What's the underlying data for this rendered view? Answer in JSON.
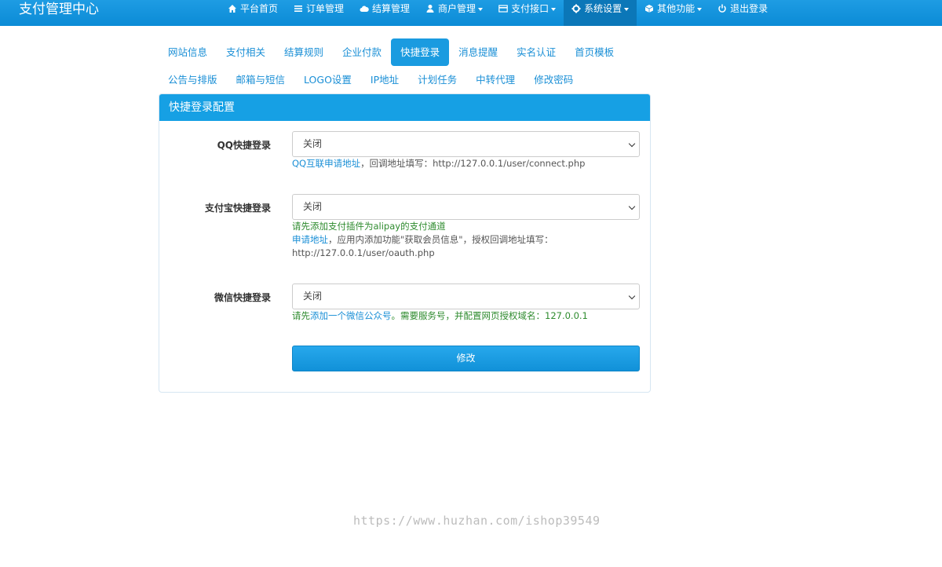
{
  "brand": "支付管理中心",
  "nav": [
    {
      "label": "平台首页",
      "icon": "home-icon"
    },
    {
      "label": "订单管理",
      "icon": "list-icon"
    },
    {
      "label": "结算管理",
      "icon": "cloud-icon"
    },
    {
      "label": "商户管理",
      "icon": "user-icon",
      "dropdown": true
    },
    {
      "label": "支付接口",
      "icon": "card-icon",
      "dropdown": true
    },
    {
      "label": "系统设置",
      "icon": "gear-icon",
      "dropdown": true,
      "active": true
    },
    {
      "label": "其他功能",
      "icon": "cube-icon",
      "dropdown": true
    },
    {
      "label": "退出登录",
      "icon": "power-icon"
    }
  ],
  "tabs": {
    "row1": [
      "网站信息",
      "支付相关",
      "结算规则",
      "企业付款",
      "快捷登录",
      "消息提醒",
      "实名认证",
      "首页模板"
    ],
    "row2": [
      "公告与排版",
      "邮箱与短信",
      "LOGO设置",
      "IP地址",
      "计划任务",
      "中转代理",
      "修改密码"
    ],
    "active": "快捷登录"
  },
  "panel": {
    "title": "快捷登录配置",
    "qq": {
      "label": "QQ快捷登录",
      "value": "关闭",
      "help_link": "QQ互联申请地址",
      "help_text": "，回调地址填写：http://127.0.0.1/user/connect.php"
    },
    "alipay": {
      "label": "支付宝快捷登录",
      "value": "关闭",
      "help_notice": "请先添加支付插件为alipay的支付通道",
      "help_link": "申请地址",
      "help_text": "，应用内添加功能\"获取会员信息\"，授权回调地址填写：",
      "help_url": "http://127.0.0.1/user/oauth.php"
    },
    "wechat": {
      "label": "微信快捷登录",
      "value": "关闭",
      "help_notice_pre": "请先",
      "help_link": "添加一个微信公众号",
      "help_notice_post": "。需要服务号，并配置网页授权域名：127.0.0.1"
    },
    "submit_label": "修改"
  },
  "watermark": "https://www.huzhan.com/ishop39549",
  "colors": {
    "primary": "#16a0e4",
    "nav_active": "#0b77b8",
    "link": "#1a8fd6",
    "notice": "#2e8b2e"
  }
}
